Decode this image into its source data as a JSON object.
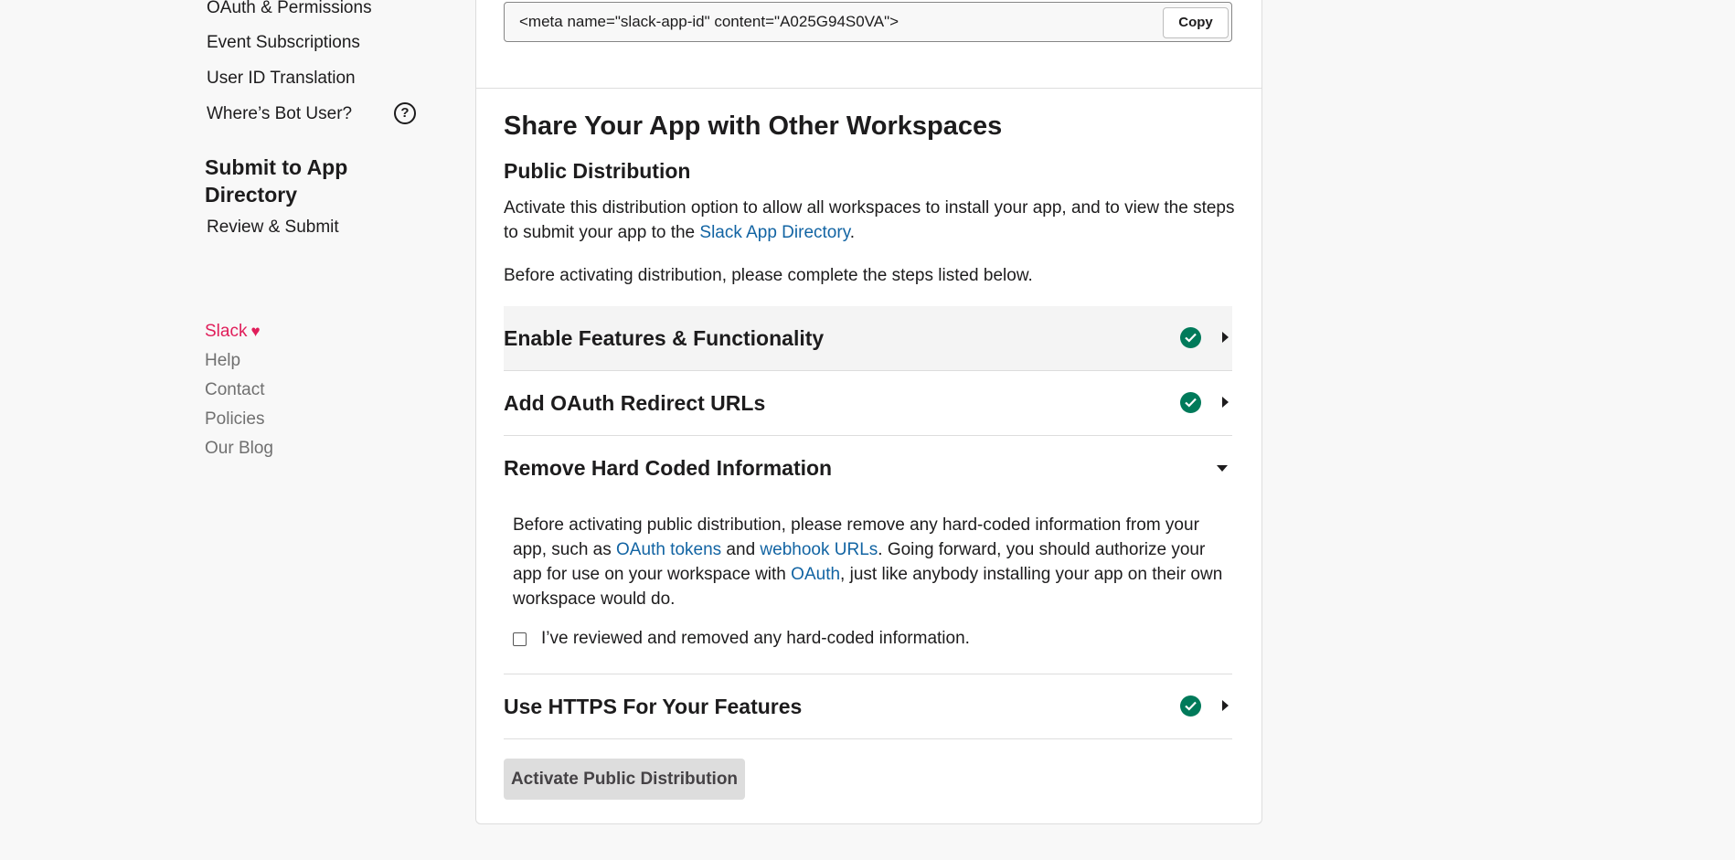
{
  "sidebar": {
    "items": [
      {
        "label": "OAuth & Permissions"
      },
      {
        "label": "Event Subscriptions"
      },
      {
        "label": "User ID Translation"
      },
      {
        "label": "Where’s Bot User?"
      }
    ],
    "help_icon_glyph": "?",
    "heading": "Submit to App Directory",
    "review_item": "Review & Submit",
    "footer": {
      "brand": "Slack",
      "heart": "♥",
      "links": [
        "Help",
        "Contact",
        "Policies",
        "Our Blog"
      ]
    }
  },
  "meta": {
    "code": "<meta name=\"slack-app-id\" content=\"A025G94S0VA\">",
    "copy_label": "Copy"
  },
  "share": {
    "title": "Share Your App with Other Workspaces",
    "subtitle": "Public Distribution",
    "intro_before": "Activate this distribution option to allow all workspaces to install your app, and to view the steps to submit your app to the ",
    "intro_link": "Slack App Directory",
    "intro_after": ".",
    "note": "Before activating distribution, please complete the steps listed below."
  },
  "accordion": [
    {
      "title": "Enable Features & Functionality",
      "complete": true,
      "expanded": false
    },
    {
      "title": "Add OAuth Redirect URLs",
      "complete": true,
      "expanded": false
    },
    {
      "title": "Remove Hard Coded Information",
      "complete": false,
      "expanded": true
    },
    {
      "title": "Use HTTPS For Your Features",
      "complete": true,
      "expanded": false
    }
  ],
  "hardcoded": {
    "text1": "Before activating public distribution, please remove any hard-coded information from your app, such as ",
    "link1": "OAuth tokens",
    "text2": " and ",
    "link2": "webhook URLs",
    "text3": ". Going forward, you should authorize your app for use on your workspace with ",
    "link3": "OAuth",
    "text4": ", just like anybody installing your app on their own workspace would do.",
    "checkbox_label": "I’ve reviewed and removed any hard-coded information.",
    "checked": false
  },
  "activate_label": "Activate Public Distribution",
  "colors": {
    "link": "#1264a3",
    "success": "#007a5a",
    "brand": "#e01e5a"
  }
}
